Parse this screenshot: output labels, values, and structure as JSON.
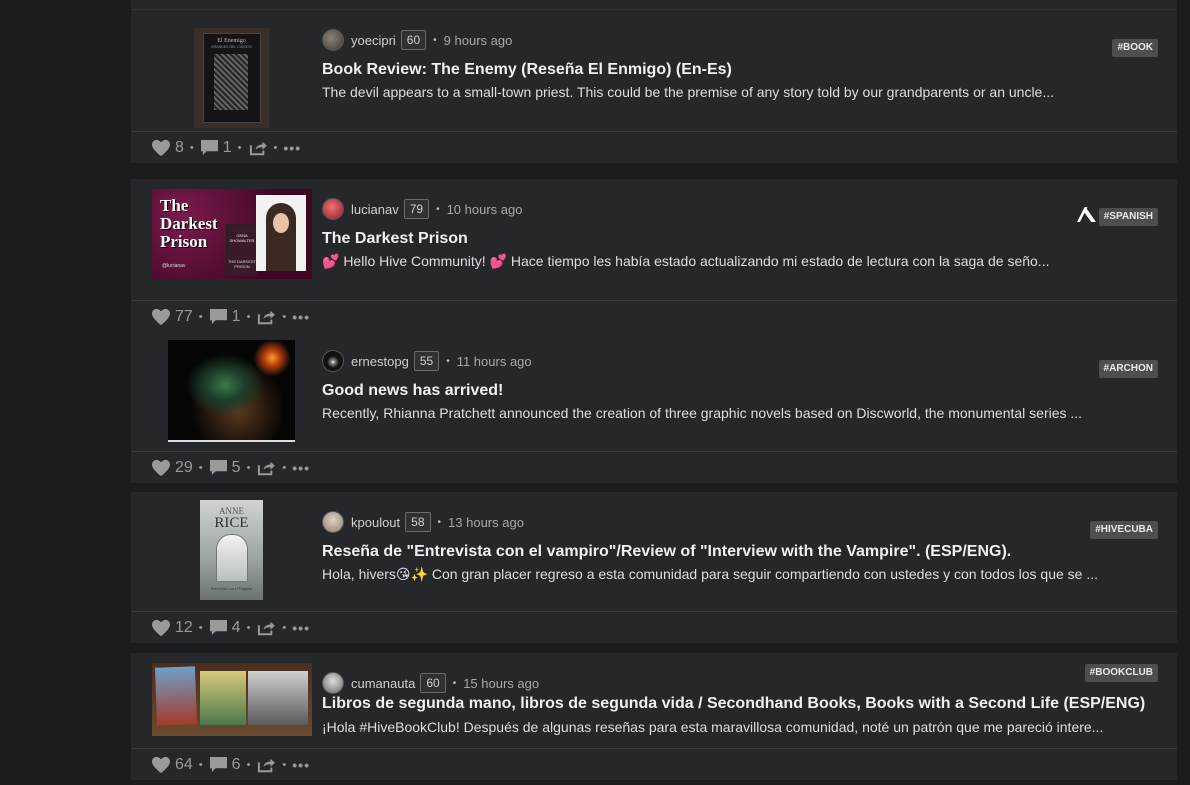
{
  "posts": [
    {
      "author": "yoecipri",
      "reputation": "60",
      "time": "9 hours ago",
      "tag": "#BOOK",
      "title": "Book Review: The Enemy (Reseña El Enmigo) (En-Es)",
      "summary": "The devil appears to a small-town priest. This could be the premise of any story told by our grandparents or an uncle...",
      "votes": "8",
      "comments": "1",
      "thumb": {
        "header": "El Enemigo",
        "subheader": "GRANDES DEL CUENTO"
      }
    },
    {
      "author": "lucianav",
      "reputation": "79",
      "time": "10 hours ago",
      "tag": "#SPANISH",
      "title": "The Darkest Prison",
      "summary": "💕 Hello Hive Community! 💕 Hace tiempo les había estado actualizando mi estado de lectura con la saga de seño...",
      "votes": "77",
      "comments": "1",
      "thumb": {
        "line1": "The",
        "line2": "Darkest",
        "line3": "Prison",
        "cover_author": "GENA SHOWALTER",
        "cover_title": "THE DARKEST PRISON",
        "handle": "@lucianav"
      }
    },
    {
      "author": "ernestopg",
      "reputation": "55",
      "time": "11 hours ago",
      "tag": "#ARCHON",
      "title": "Good news has arrived!",
      "summary": "Recently, Rhianna Pratchett announced the creation of three graphic novels based on Discworld, the monumental series ...",
      "votes": "29",
      "comments": "5",
      "thumb": {}
    },
    {
      "author": "kpoulout",
      "reputation": "58",
      "time": "13 hours ago",
      "tag": "#HIVECUBA",
      "title": "Reseña de \"Entrevista con el vampiro\"/Review of \"Interview with the Vampire\". (ESP/ENG).",
      "summary": "Hola, hivers😘✨ Con gran placer regreso a esta comunidad para seguir compartiendo con ustedes y con todos los que se ...",
      "votes": "12",
      "comments": "4",
      "thumb": {
        "line1": "ANNE",
        "line2": "RICE",
        "line3": "Entrevista con el Vampiro"
      }
    },
    {
      "author": "cumanauta",
      "reputation": "60",
      "time": "15 hours ago",
      "tag": "#BOOKCLUB",
      "title": "Libros de segunda mano, libros de segunda vida / Secondhand Books, Books with a Second Life (ESP/ENG)",
      "summary": "¡Hola #HiveBookClub! Después de algunas reseñas para esta maravillosa comunidad, noté un patrón que me pareció intere...",
      "votes": "64",
      "comments": "6",
      "thumb": {}
    }
  ],
  "colors": {
    "background": "#1b1c1e",
    "card": "#26272a",
    "tag": "#4d4e52",
    "accent_pink": "#e0306a"
  },
  "icons": {
    "vote": "heart-icon",
    "comment": "comment-icon",
    "reblog": "share-icon",
    "more": "ellipsis-icon"
  }
}
